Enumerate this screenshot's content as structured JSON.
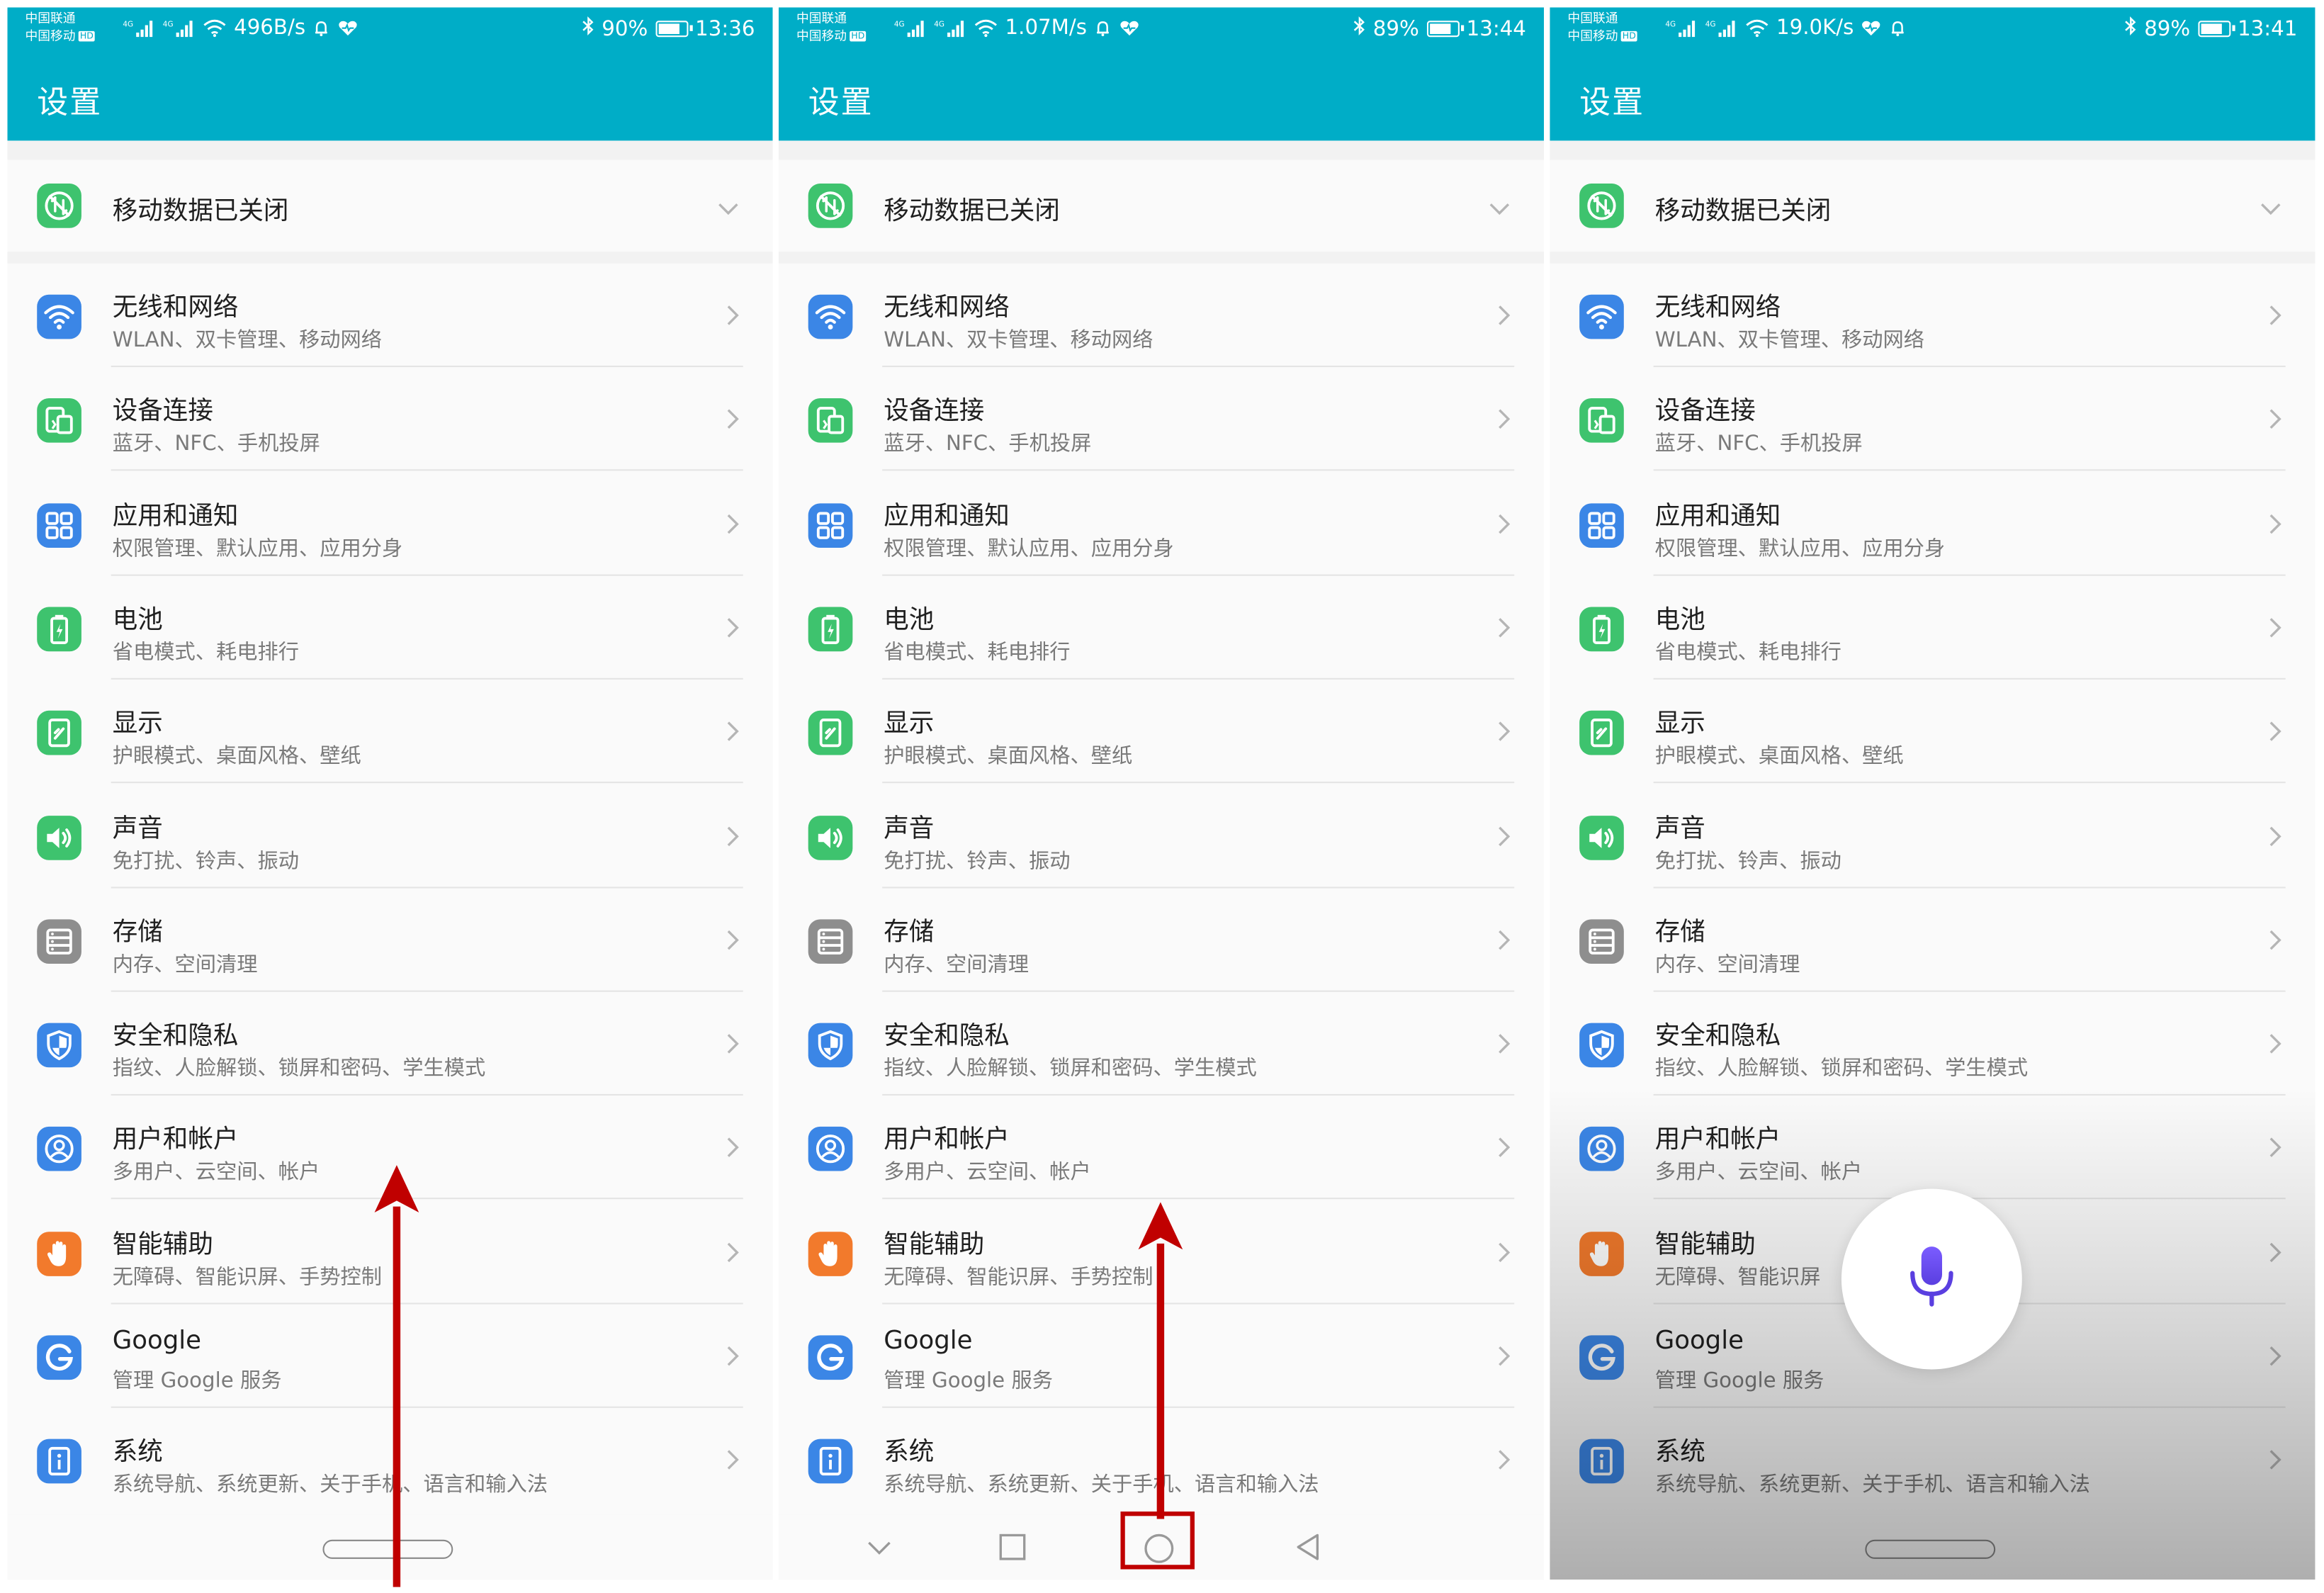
{
  "panels": [
    {
      "carrier1": "中国联通",
      "carrier2": "中国移动",
      "hd": "HD",
      "net_speed": "496B/s",
      "battery": "90%",
      "battery_level": 0.9,
      "time": "13:36",
      "title": "设置",
      "mobile_data": "移动数据已关闭",
      "items": [
        {
          "label": "无线和网络",
          "sub": "WLAN、双卡管理、移动网络",
          "icon": "wifi-icon"
        },
        {
          "label": "设备连接",
          "sub": "蓝牙、NFC、手机投屏",
          "icon": "device-connection-icon"
        },
        {
          "label": "应用和通知",
          "sub": "权限管理、默认应用、应用分身",
          "icon": "apps-icon"
        },
        {
          "label": "电池",
          "sub": "省电模式、耗电排行",
          "icon": "battery-icon"
        },
        {
          "label": "显示",
          "sub": "护眼模式、桌面风格、壁纸",
          "icon": "display-icon"
        },
        {
          "label": "声音",
          "sub": "免打扰、铃声、振动",
          "icon": "sound-icon"
        },
        {
          "label": "存储",
          "sub": "内存、空间清理",
          "icon": "storage-icon"
        },
        {
          "label": "安全和隐私",
          "sub": "指纹、人脸解锁、锁屏和密码、学生模式",
          "icon": "shield-icon"
        },
        {
          "label": "用户和帐户",
          "sub": "多用户、云空间、帐户",
          "icon": "user-icon"
        },
        {
          "label": "智能辅助",
          "sub": "无障碍、智能识屏、手势控制",
          "icon": "hand-icon"
        },
        {
          "label": "Google",
          "sub": "管理 Google 服务",
          "icon": "google-icon"
        },
        {
          "label": "系统",
          "sub": "系统导航、系统更新、关于手机、语言和输入法",
          "icon": "system-icon"
        }
      ]
    },
    {
      "carrier1": "中国联通",
      "carrier2": "中国移动",
      "hd": "HD",
      "net_speed": "1.07M/s",
      "battery": "89%",
      "battery_level": 0.89,
      "time": "13:44",
      "title": "设置",
      "mobile_data": "移动数据已关闭",
      "items": [
        {
          "label": "无线和网络",
          "sub": "WLAN、双卡管理、移动网络",
          "icon": "wifi-icon"
        },
        {
          "label": "设备连接",
          "sub": "蓝牙、NFC、手机投屏",
          "icon": "device-connection-icon"
        },
        {
          "label": "应用和通知",
          "sub": "权限管理、默认应用、应用分身",
          "icon": "apps-icon"
        },
        {
          "label": "电池",
          "sub": "省电模式、耗电排行",
          "icon": "battery-icon"
        },
        {
          "label": "显示",
          "sub": "护眼模式、桌面风格、壁纸",
          "icon": "display-icon"
        },
        {
          "label": "声音",
          "sub": "免打扰、铃声、振动",
          "icon": "sound-icon"
        },
        {
          "label": "存储",
          "sub": "内存、空间清理",
          "icon": "storage-icon"
        },
        {
          "label": "安全和隐私",
          "sub": "指纹、人脸解锁、锁屏和密码、学生模式",
          "icon": "shield-icon"
        },
        {
          "label": "用户和帐户",
          "sub": "多用户、云空间、帐户",
          "icon": "user-icon"
        },
        {
          "label": "智能辅助",
          "sub": "无障碍、智能识屏、手势控制",
          "icon": "hand-icon"
        },
        {
          "label": "Google",
          "sub": "管理 Google 服务",
          "icon": "google-icon"
        },
        {
          "label": "系统",
          "sub": "系统导航、系统更新、关于手机、语言和输入法",
          "icon": "system-icon"
        }
      ]
    },
    {
      "carrier1": "中国联通",
      "carrier2": "中国移动",
      "hd": "HD",
      "net_speed": "19.0K/s",
      "battery": "89%",
      "battery_level": 0.89,
      "time": "13:41",
      "title": "设置",
      "mobile_data": "移动数据已关闭",
      "items": [
        {
          "label": "无线和网络",
          "sub": "WLAN、双卡管理、移动网络",
          "icon": "wifi-icon"
        },
        {
          "label": "设备连接",
          "sub": "蓝牙、NFC、手机投屏",
          "icon": "device-connection-icon"
        },
        {
          "label": "应用和通知",
          "sub": "权限管理、默认应用、应用分身",
          "icon": "apps-icon"
        },
        {
          "label": "电池",
          "sub": "省电模式、耗电排行",
          "icon": "battery-icon"
        },
        {
          "label": "显示",
          "sub": "护眼模式、桌面风格、壁纸",
          "icon": "display-icon"
        },
        {
          "label": "声音",
          "sub": "免打扰、铃声、振动",
          "icon": "sound-icon"
        },
        {
          "label": "存储",
          "sub": "内存、空间清理",
          "icon": "storage-icon"
        },
        {
          "label": "安全和隐私",
          "sub": "指纹、人脸解锁、锁屏和密码、学生模式",
          "icon": "shield-icon"
        },
        {
          "label": "用户和帐户",
          "sub": "多用户、云空间、帐户",
          "icon": "user-icon"
        },
        {
          "label": "智能辅助",
          "sub": "无障碍、智能识屏",
          "icon": "hand-icon"
        },
        {
          "label": "Google",
          "sub": "管理 Google 服务",
          "icon": "google-icon"
        },
        {
          "label": "系统",
          "sub": "系统导航、系统更新、关于手机、语言和输入法",
          "icon": "system-icon"
        }
      ]
    }
  ],
  "colors": {
    "header": "#00adc7",
    "green_icon": "#3ec36e",
    "blue_icon": "#3b86e6",
    "gray_icon": "#8e8e8e",
    "orange_icon": "#f27a2c",
    "annotation_red": "#c00000",
    "mic": "#6a4dff"
  }
}
